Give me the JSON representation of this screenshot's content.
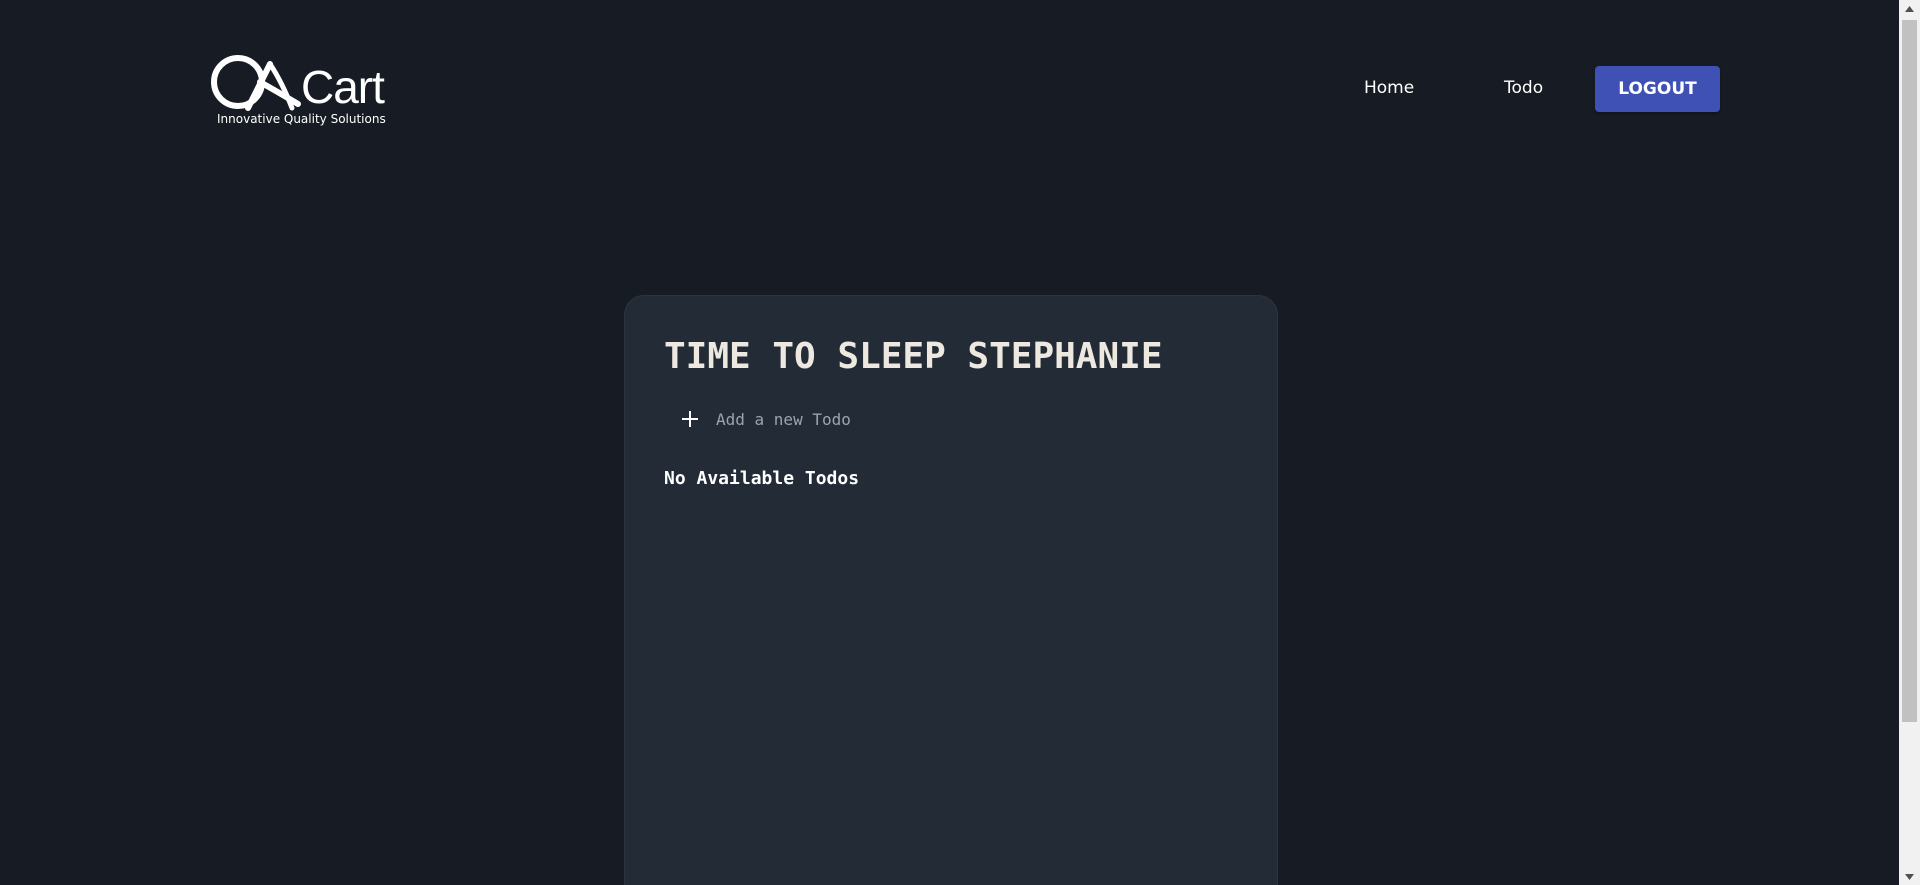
{
  "header": {
    "logo_brand": "QACart",
    "logo_tagline": "Innovative Quality Solutions",
    "nav": {
      "home_label": "Home",
      "todo_label": "Todo"
    },
    "logout_label": "LOGOUT"
  },
  "main": {
    "title": "TIME TO SLEEP STEPHANIE",
    "add_placeholder": "Add a new Todo",
    "empty_message": "No Available Todos"
  },
  "colors": {
    "background": "#171c24",
    "card": "#222b36",
    "accent": "#3f51b5"
  },
  "icons": {
    "add": "plus-icon",
    "scroll_up": "chevron-up-icon",
    "scroll_down": "chevron-down-icon"
  }
}
